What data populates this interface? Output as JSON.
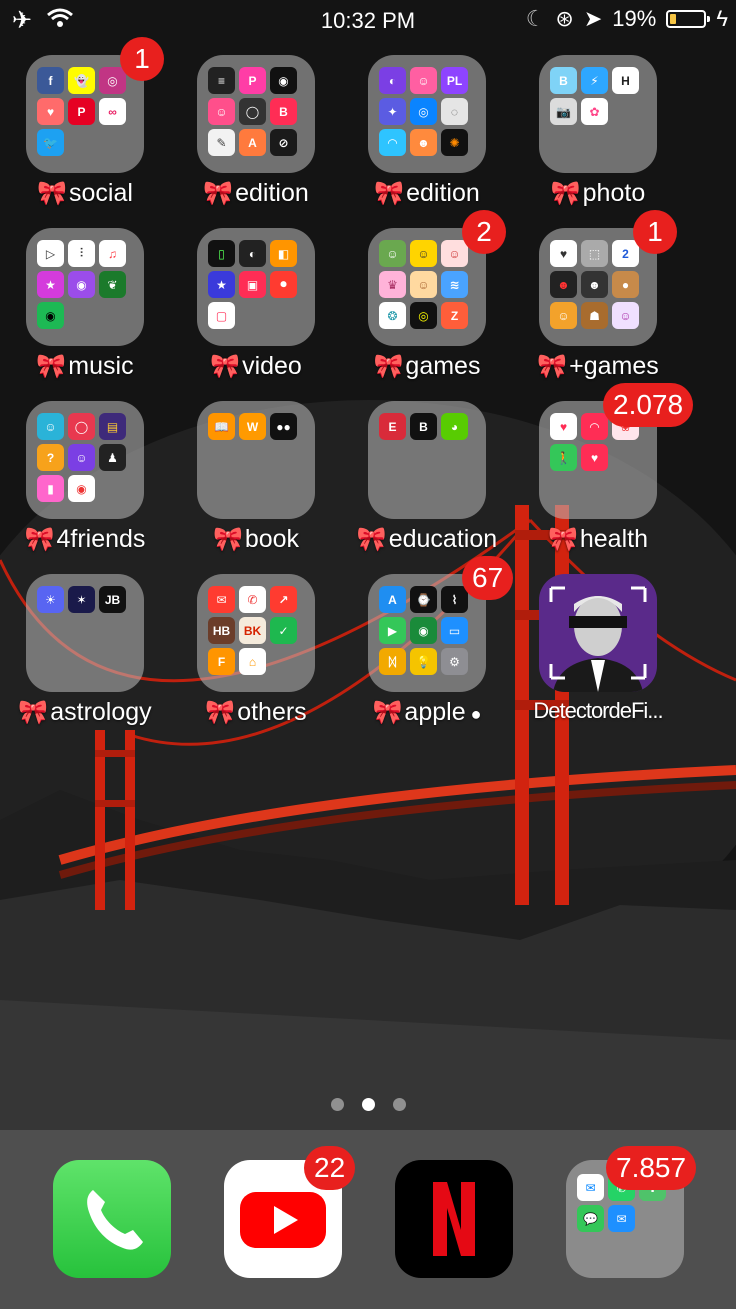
{
  "status_bar": {
    "time": "10:32 PM",
    "battery_percent": "19%",
    "battery_level": 0.19,
    "battery_color": "#f6c544"
  },
  "folders": [
    {
      "label": "social",
      "badge": "1",
      "minis": [
        {
          "name": "facebook-icon",
          "color": "#3b5998",
          "glyph": "f"
        },
        {
          "name": "snapchat-icon",
          "color": "#fffc00",
          "glyph": "👻"
        },
        {
          "name": "instagram-icon",
          "color": "#c13584",
          "glyph": "◎"
        },
        {
          "name": "tinder-like-icon",
          "color": "#ff6b6b",
          "glyph": "♥"
        },
        {
          "name": "pinterest-icon",
          "color": "#e60023",
          "glyph": "P"
        },
        {
          "name": "infinity-icon",
          "color": "#ffffff",
          "glyph": "∞",
          "fg": "#e91e63"
        },
        {
          "name": "twitter-icon",
          "color": "#1da1f2",
          "glyph": "🐦"
        }
      ]
    },
    {
      "label": "edition",
      "badge": "",
      "minis": [
        {
          "name": "app-icon-1",
          "color": "#222",
          "glyph": "≡"
        },
        {
          "name": "picsart-icon",
          "color": "#ff3da6",
          "glyph": "P"
        },
        {
          "name": "camera-lens-icon",
          "color": "#111",
          "glyph": "◉"
        },
        {
          "name": "faceapp-icon",
          "color": "#ff4f8b",
          "glyph": "☺"
        },
        {
          "name": "vsco-icon",
          "color": "#333",
          "glyph": "◯"
        },
        {
          "name": "app-icon-2",
          "color": "#ff2d55",
          "glyph": "B"
        },
        {
          "name": "eraser-icon",
          "color": "#f2f2f2",
          "glyph": "✎",
          "fg": "#444"
        },
        {
          "name": "affinity-icon",
          "color": "#ff7a3d",
          "glyph": "A"
        },
        {
          "name": "darkroom-icon",
          "color": "#1a1a1a",
          "glyph": "⊘"
        }
      ]
    },
    {
      "label": "edition",
      "badge": "",
      "minis": [
        {
          "name": "app-icon-3",
          "color": "#7b3fe4",
          "glyph": "◐"
        },
        {
          "name": "app-icon-4",
          "color": "#ff5fa2",
          "glyph": "☺"
        },
        {
          "name": "photo-lab-icon",
          "color": "#8e44ff",
          "glyph": "PL"
        },
        {
          "name": "app-icon-5",
          "color": "#5b5ce2",
          "glyph": "✦"
        },
        {
          "name": "app-icon-6",
          "color": "#0a84ff",
          "glyph": "◎"
        },
        {
          "name": "app-icon-7",
          "color": "#e5e5e5",
          "glyph": "◌",
          "fg": "#555"
        },
        {
          "name": "app-icon-8",
          "color": "#2ec4ff",
          "glyph": "◠"
        },
        {
          "name": "app-icon-9",
          "color": "#ff8a3d",
          "glyph": "☻"
        },
        {
          "name": "app-icon-10",
          "color": "#111",
          "glyph": "✺",
          "fg": "#ff8a00"
        }
      ]
    },
    {
      "label": "photo",
      "badge": "",
      "minis": [
        {
          "name": "b612-icon",
          "color": "#7fd3f7",
          "glyph": "B"
        },
        {
          "name": "app-icon-11",
          "color": "#2ea7ff",
          "glyph": "⚡"
        },
        {
          "name": "huji-icon",
          "color": "#ffffff",
          "glyph": "H",
          "fg": "#222"
        },
        {
          "name": "camera-icon",
          "color": "#dcdcdc",
          "glyph": "📷",
          "fg": "#333"
        },
        {
          "name": "photos-icon",
          "color": "#ffffff",
          "glyph": "✿",
          "fg": "#f48"
        }
      ]
    },
    {
      "label": "music",
      "badge": "",
      "minis": [
        {
          "name": "play-icon",
          "color": "#ffffff",
          "glyph": "▷",
          "fg": "#333"
        },
        {
          "name": "voice-memos-icon",
          "color": "#ffffff",
          "glyph": "⫶",
          "fg": "#333"
        },
        {
          "name": "music-icon",
          "color": "#ffffff",
          "glyph": "♫",
          "fg": "#fc3c44"
        },
        {
          "name": "itunes-store-icon",
          "color": "#d43bdc",
          "glyph": "★"
        },
        {
          "name": "podcasts-icon",
          "color": "#9b4dea",
          "glyph": "◉"
        },
        {
          "name": "app-icon-12",
          "color": "#1b7a2b",
          "glyph": "❦"
        },
        {
          "name": "spotify-like-icon",
          "color": "#1db954",
          "glyph": "◉",
          "fg": "#000"
        }
      ]
    },
    {
      "label": "video",
      "badge": "",
      "minis": [
        {
          "name": "app-icon-13",
          "color": "#111",
          "glyph": "▯",
          "fg": "#5f5"
        },
        {
          "name": "app-icon-14",
          "color": "#222",
          "glyph": "◐"
        },
        {
          "name": "app-icon-15",
          "color": "#ff9500",
          "glyph": "◧"
        },
        {
          "name": "imovie-star-icon",
          "color": "#3a3adb",
          "glyph": "★"
        },
        {
          "name": "app-icon-16",
          "color": "#ff2d55",
          "glyph": "▣"
        },
        {
          "name": "app-icon-17",
          "color": "#ff3b30",
          "glyph": "⏺"
        },
        {
          "name": "app-icon-18",
          "color": "#ffffff",
          "glyph": "▢",
          "fg": "#ff2d55"
        }
      ]
    },
    {
      "label": "games",
      "badge": "2",
      "minis": [
        {
          "name": "talking-tom-icon",
          "color": "#6aa84f",
          "glyph": "☺"
        },
        {
          "name": "app-icon-19",
          "color": "#ffd400",
          "glyph": "☺",
          "fg": "#333"
        },
        {
          "name": "app-icon-20",
          "color": "#ffdede",
          "glyph": "☺",
          "fg": "#c33"
        },
        {
          "name": "app-icon-21",
          "color": "#ffb3d9",
          "glyph": "♛",
          "fg": "#a36"
        },
        {
          "name": "app-icon-22",
          "color": "#ffd9a0",
          "glyph": "☺",
          "fg": "#a63"
        },
        {
          "name": "app-icon-23",
          "color": "#4aa3ff",
          "glyph": "≋"
        },
        {
          "name": "app-icon-24",
          "color": "#ffffff",
          "glyph": "❂",
          "fg": "#29a"
        },
        {
          "name": "app-icon-25",
          "color": "#111",
          "glyph": "◎",
          "fg": "#ff0"
        },
        {
          "name": "app-icon-26",
          "color": "#ff5e3a",
          "glyph": "Z"
        }
      ]
    },
    {
      "label": "+games",
      "badge": "1",
      "minis": [
        {
          "name": "app-icon-27",
          "color": "#ffffff",
          "glyph": "♥",
          "fg": "#333"
        },
        {
          "name": "app-icon-28",
          "color": "#aaa",
          "glyph": "⬚"
        },
        {
          "name": "app-icon-29",
          "color": "#ffffff",
          "glyph": "2",
          "fg": "#1f5ad8"
        },
        {
          "name": "app-icon-30",
          "color": "#222",
          "glyph": "☻",
          "fg": "#f33"
        },
        {
          "name": "app-icon-31",
          "color": "#333",
          "glyph": "☻"
        },
        {
          "name": "pou-icon",
          "color": "#c78a4a",
          "glyph": "●"
        },
        {
          "name": "subway-surfers-icon",
          "color": "#f3a22b",
          "glyph": "☺"
        },
        {
          "name": "temple-run-icon",
          "color": "#a86c2e",
          "glyph": "☗"
        },
        {
          "name": "app-icon-32",
          "color": "#f0e0ff",
          "glyph": "☺",
          "fg": "#a3a"
        }
      ]
    },
    {
      "label": "4friends",
      "badge": "",
      "minis": [
        {
          "name": "app-icon-33",
          "color": "#2ab3d8",
          "glyph": "☺"
        },
        {
          "name": "app-icon-34",
          "color": "#e8384f",
          "glyph": "◯"
        },
        {
          "name": "app-icon-35",
          "color": "#3e2a7a",
          "glyph": "▤",
          "fg": "#fc3"
        },
        {
          "name": "quiz-icon",
          "color": "#f7a21b",
          "glyph": "?"
        },
        {
          "name": "app-icon-36",
          "color": "#7b3fe4",
          "glyph": "☺"
        },
        {
          "name": "app-icon-37",
          "color": "#222",
          "glyph": "♟"
        },
        {
          "name": "app-icon-38",
          "color": "#ff66cc",
          "glyph": "▮"
        },
        {
          "name": "chrome-like-icon",
          "color": "#ffffff",
          "glyph": "◉",
          "fg": "#e33"
        }
      ]
    },
    {
      "label": "book",
      "badge": "",
      "minis": [
        {
          "name": "books-icon",
          "color": "#ff9500",
          "glyph": "📖"
        },
        {
          "name": "wattpad-icon",
          "color": "#ff9a00",
          "glyph": "W"
        },
        {
          "name": "app-icon-39",
          "color": "#111",
          "glyph": "●●"
        }
      ]
    },
    {
      "label": "education",
      "badge": "",
      "minis": [
        {
          "name": "app-icon-40",
          "color": "#d92b3a",
          "glyph": "E"
        },
        {
          "name": "app-icon-41",
          "color": "#111",
          "glyph": "B"
        },
        {
          "name": "duolingo-icon",
          "color": "#58cc02",
          "glyph": "◕"
        }
      ]
    },
    {
      "label": "health",
      "badge": "2.078",
      "minis": [
        {
          "name": "health-icon",
          "color": "#ffffff",
          "glyph": "♥",
          "fg": "#ff2d55"
        },
        {
          "name": "app-icon-42",
          "color": "#ff2d55",
          "glyph": "◠"
        },
        {
          "name": "app-icon-43",
          "color": "#ffe5ec",
          "glyph": "❀",
          "fg": "#e33"
        },
        {
          "name": "fitness-walk-icon",
          "color": "#34c759",
          "glyph": "🚶"
        },
        {
          "name": "app-icon-44",
          "color": "#ff2d55",
          "glyph": "♥"
        }
      ]
    },
    {
      "label": "astrology",
      "badge": "",
      "minis": [
        {
          "name": "sun-icon",
          "color": "#5865f2",
          "glyph": "☀"
        },
        {
          "name": "app-icon-45",
          "color": "#1a1a4a",
          "glyph": "✶"
        },
        {
          "name": "app-icon-46",
          "color": "#111",
          "glyph": "JB"
        }
      ]
    },
    {
      "label": "others",
      "badge": "",
      "minis": [
        {
          "name": "app-icon-47",
          "color": "#ff3b30",
          "glyph": "✉"
        },
        {
          "name": "phone-red-icon",
          "color": "#ffffff",
          "glyph": "✆",
          "fg": "#e33"
        },
        {
          "name": "app-icon-48",
          "color": "#ff3b30",
          "glyph": "↗"
        },
        {
          "name": "holy-bible-icon",
          "color": "#6b3d2a",
          "glyph": "HB"
        },
        {
          "name": "burger-king-icon",
          "color": "#f5ebdc",
          "glyph": "BK",
          "fg": "#d62300"
        },
        {
          "name": "app-icon-49",
          "color": "#1eb84f",
          "glyph": "✓"
        },
        {
          "name": "app-icon-50",
          "color": "#ff9500",
          "glyph": "F"
        },
        {
          "name": "home-icon",
          "color": "#ffffff",
          "glyph": "⌂",
          "fg": "#f90"
        }
      ]
    },
    {
      "label": "apple",
      "badge": "67",
      "suffix": "",
      "minis": [
        {
          "name": "app-store-icon",
          "color": "#1f8ef1",
          "glyph": "A"
        },
        {
          "name": "watch-icon",
          "color": "#111",
          "glyph": "⌚"
        },
        {
          "name": "stocks-icon",
          "color": "#111",
          "glyph": "⌇"
        },
        {
          "name": "facetime-icon",
          "color": "#34c759",
          "glyph": "▶"
        },
        {
          "name": "find-my-icon",
          "color": "#1a8b3a",
          "glyph": "◉"
        },
        {
          "name": "files-icon",
          "color": "#1e90ff",
          "glyph": "▭"
        },
        {
          "name": "family-icon",
          "color": "#f2a900",
          "glyph": "ᛞ"
        },
        {
          "name": "tips-icon",
          "color": "#f5c400",
          "glyph": "💡"
        },
        {
          "name": "settings-icon",
          "color": "#8e8e93",
          "glyph": "⚙"
        }
      ]
    }
  ],
  "single_app": {
    "label": "DetectordeFi...",
    "badge": ""
  },
  "dock": [
    {
      "name": "phone-app",
      "badge": "",
      "color": "#34c759"
    },
    {
      "name": "youtube-app",
      "badge": "22",
      "color": "#ffffff"
    },
    {
      "name": "netflix-app",
      "badge": "",
      "color": "#000000"
    },
    {
      "name": "messaging-folder",
      "badge": "7.857",
      "color": "rgba(190,190,190,0.55)"
    }
  ],
  "dock_folder_minis": [
    {
      "name": "messenger-icon",
      "color": "#ffffff",
      "glyph": "✉",
      "fg": "#0084ff"
    },
    {
      "name": "whatsapp-icon",
      "color": "#25d366",
      "glyph": "✆"
    },
    {
      "name": "app-icon-51",
      "color": "#4fc36a",
      "glyph": "✚"
    },
    {
      "name": "messages-icon",
      "color": "#34c759",
      "glyph": "💬"
    },
    {
      "name": "mail-icon",
      "color": "#1e90ff",
      "glyph": "✉"
    }
  ],
  "page_dots": {
    "count": 3,
    "active": 2
  }
}
